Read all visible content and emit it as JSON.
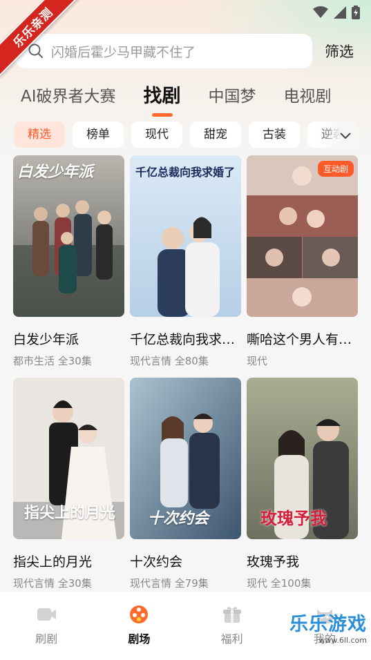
{
  "status_bar": {
    "icons": [
      "wifi-icon",
      "signal-icon",
      "battery-icon"
    ]
  },
  "ribbon": {
    "text": "乐乐亲测"
  },
  "search": {
    "placeholder": "闪婚后霍少马甲藏不住了",
    "filter_label": "筛选"
  },
  "main_tabs": [
    {
      "label": "AI破界者大赛",
      "active": false
    },
    {
      "label": "找剧",
      "active": true
    },
    {
      "label": "中国梦",
      "active": false
    },
    {
      "label": "电视剧",
      "active": false
    }
  ],
  "chips": [
    {
      "label": "精选",
      "active": true
    },
    {
      "label": "榜单",
      "active": false
    },
    {
      "label": "现代",
      "active": false
    },
    {
      "label": "甜宠",
      "active": false
    },
    {
      "label": "古装",
      "active": false
    },
    {
      "label": "逆袭",
      "active": false
    }
  ],
  "dramas": [
    {
      "title": "白发少年派",
      "meta": "都市生活 全30集",
      "poster_text": "白发少年派",
      "badge": ""
    },
    {
      "title": "千亿总裁向我求…",
      "meta": "现代言情 全80集",
      "poster_text": "千亿总裁向我求婚了",
      "badge": ""
    },
    {
      "title": "嘶哈这个男人有…",
      "meta": "现代",
      "poster_text": "",
      "badge": "互动剧"
    },
    {
      "title": "指尖上的月光",
      "meta": "现代言情 全30集",
      "poster_text": "指尖上的月光",
      "badge": ""
    },
    {
      "title": "十次约会",
      "meta": "现代言情 全79集",
      "poster_text": "十次约会",
      "badge": ""
    },
    {
      "title": "玫瑰予我",
      "meta": "现代 全100集",
      "poster_text": "玫瑰予我",
      "badge": ""
    }
  ],
  "bottom_nav": [
    {
      "label": "刷剧",
      "icon": "video-play-icon",
      "active": false
    },
    {
      "label": "剧场",
      "icon": "film-reel-icon",
      "active": true
    },
    {
      "label": "福利",
      "icon": "gift-icon",
      "active": false
    },
    {
      "label": "我的",
      "icon": "cat-face-icon",
      "active": false
    }
  ],
  "watermark": {
    "text": "乐乐游戏",
    "url": "www.6ll.com"
  },
  "colors": {
    "accent": "#ff5a2a",
    "tab_underline": "#ff6a2a",
    "chip_active_bg": "#ffe5dc"
  }
}
